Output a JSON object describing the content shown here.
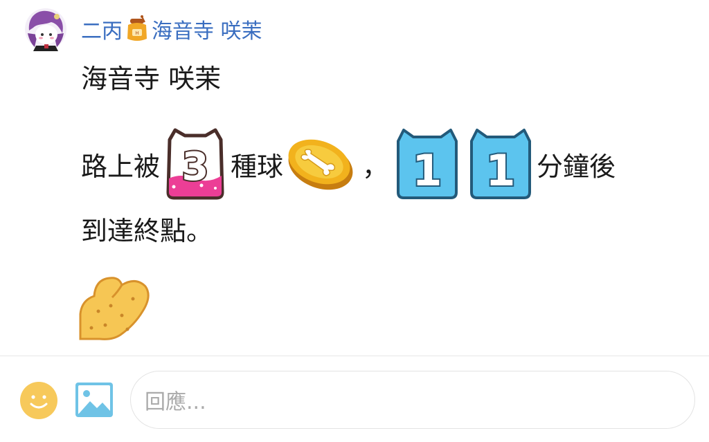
{
  "author": {
    "name_prefix": "二丙",
    "name_suffix": "海音寺 咲茉",
    "badge_icon": "honey-jar-icon",
    "avatar_icon": "avatar-purple-hair-girl"
  },
  "message": {
    "line1": "海音寺 咲茉",
    "line2": {
      "text_a": "路上被",
      "sticker_3": "3",
      "text_b": "種球",
      "text_c": "，",
      "sticker_1a": "1",
      "sticker_1b": "1",
      "text_d": "分鐘後"
    },
    "line3": "到達終點。",
    "bottom_sticker": "cookie-sticker"
  },
  "composer": {
    "placeholder": "回應...",
    "emoji_icon": "smiley-icon",
    "image_icon": "image-icon"
  },
  "colors": {
    "name": "#3a6ec0",
    "accent_blue": "#5cc4ee",
    "emoji_yellow": "#f7c95b",
    "image_blue": "#6fc3e6"
  }
}
